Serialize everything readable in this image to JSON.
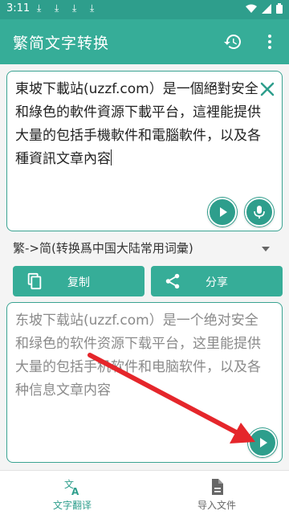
{
  "status_bar": {
    "time": "3:11",
    "download_icons": [
      "download-icon",
      "download-icon",
      "download-icon",
      "download-icon"
    ],
    "right_icons": [
      "wifi-icon",
      "signal-icon",
      "battery-icon"
    ]
  },
  "app_bar": {
    "title": "繁简文字转换",
    "history_icon": "history-icon",
    "menu_icon": "more-vert-icon"
  },
  "input": {
    "text": "東坡下載站(uzzf.com）是一個絕對安全和綠色的軟件資源下載平台，這裡能提供大量的包括手機軟件和電腦軟件，以及各種資訊文章內容",
    "clear_icon": "close-icon",
    "play_icon": "play-icon",
    "mic_icon": "mic-icon"
  },
  "mode": {
    "selected": "繁->简(转换爲中国大陆常用词彙)"
  },
  "actions": {
    "copy_label": "复制",
    "share_label": "分享"
  },
  "output": {
    "text": "东坡下载站(uzzf.com）是一个绝对安全和绿色的软件资源下载平台，这里能提供大量的包括手机软件和电脑软件，以及各种信息文章内容",
    "play_icon": "play-icon"
  },
  "bottom_nav": {
    "items": [
      {
        "label": "文字翻译",
        "icon": "translate-icon",
        "active": true
      },
      {
        "label": "导入文件",
        "icon": "file-icon",
        "active": false
      }
    ]
  },
  "colors": {
    "primary": "#36ad98",
    "primary_dark": "#2e9e8c",
    "arrow": "#e5262b"
  }
}
